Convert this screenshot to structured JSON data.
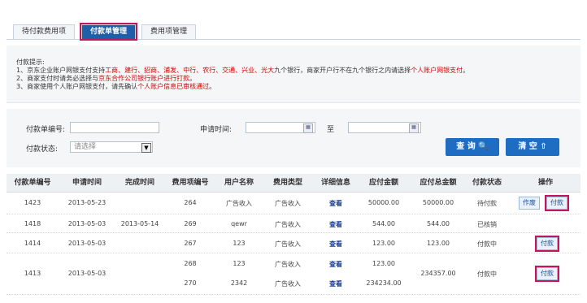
{
  "tabs": [
    "待付款费用项",
    "付款单管理",
    "费用项管理"
  ],
  "hint": {
    "title": "付款提示:",
    "line1_prefix": "1、京东企业账户网银支付支持",
    "line1_banks": "工商、建行、招商、浦发、中行、农行、交通、兴业、光大",
    "line1_mid": "九个银行，商家开户行不在九个银行之内请选择",
    "line1_red": "个人账户网银支付",
    "line1_end": "。",
    "line2_prefix": "2、商家支付时请务必选择与",
    "line2_red": "京东合作公司银行账户进行打款",
    "line2_end": "。",
    "line3_prefix": "3、商家使用个人账户网银支付，请先确认",
    "line3_red": "个人账户信息已审核通过",
    "line3_end": "。"
  },
  "search": {
    "order_no_label": "付款单编号:",
    "apply_time_label": "申请时间:",
    "to_label": "至",
    "status_label": "付款状态:",
    "status_value": "请选择",
    "query_btn": "查 询 🔍",
    "clear_btn": "清 空 ⇧"
  },
  "table": {
    "headers": [
      "付款单编号",
      "申请时间",
      "完成时间",
      "费用项编号",
      "用户名称",
      "费用类型",
      "详细信息",
      "应付金额",
      "应付总金额",
      "付款状态",
      "操作"
    ],
    "rows": [
      {
        "no": "1423",
        "apply": "2013-05-23",
        "done": "",
        "item": "264",
        "user": "广告收入",
        "type": "广告收入",
        "detail": "查看",
        "amount": "50000.00",
        "total": "50000.00",
        "status": "待付款",
        "actions": [
          "作废",
          "付款"
        ]
      },
      {
        "no": "1418",
        "apply": "2013-05-03",
        "done": "2013-05-14",
        "item": "269",
        "user": "qewr",
        "type": "广告收入",
        "detail": "查看",
        "amount": "544.00",
        "total": "544.00",
        "status": "已核销",
        "actions": []
      },
      {
        "no": "1414",
        "apply": "2013-05-03",
        "done": "",
        "item": "267",
        "user": "123",
        "type": "广告收入",
        "detail": "查看",
        "amount": "123.00",
        "total": "123.00",
        "status": "付款中",
        "actions": [
          "付款"
        ]
      },
      {
        "no": "1413",
        "apply": "2013-05-03",
        "done": "",
        "item": "268",
        "user": "123",
        "type": "广告收入",
        "detail": "查看",
        "amount": "123.00",
        "total": "234357.00",
        "status": "付款中",
        "actions": [
          "付款"
        ]
      },
      {
        "no": "",
        "apply": "",
        "done": "",
        "item": "270",
        "user": "2342",
        "type": "广告收入",
        "detail": "查看",
        "amount": "234234.00",
        "total": "",
        "status": "",
        "actions": []
      }
    ]
  }
}
